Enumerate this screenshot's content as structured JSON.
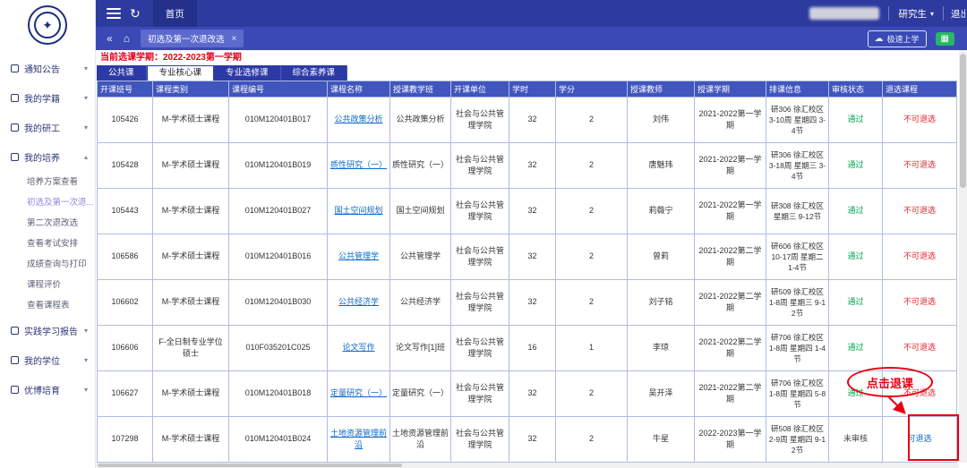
{
  "topbar": {
    "home_tab": "首页",
    "user_role": "研究生",
    "logout_label": "退出"
  },
  "tabbar": {
    "active_tab": "初选及第一次退改选",
    "close_label": "×",
    "speed_button": "极速上学"
  },
  "sidebar": {
    "items": [
      {
        "label": "通知公告"
      },
      {
        "label": "我的学籍"
      },
      {
        "label": "我的研工"
      },
      {
        "label": "我的培养",
        "expanded": true,
        "children": [
          "培养方案查看",
          "初选及第一次退...",
          "第二次退改选",
          "查看考试安排",
          "成绩查询与打印",
          "课程评价",
          "查看课程表"
        ]
      },
      {
        "label": "实践学习报告"
      },
      {
        "label": "我的学位"
      },
      {
        "label": "优博培育"
      }
    ],
    "active_child": "初选及第一次退..."
  },
  "notice": "当前选课学期：2022-2023第一学期",
  "category_tabs": [
    "公共课",
    "专业核心课",
    "专业选修课",
    "综合素养课"
  ],
  "active_category": "专业核心课",
  "table": {
    "columns": [
      "class_no",
      "category",
      "course_no",
      "course_name",
      "teaching_class",
      "unit",
      "hours",
      "credits",
      "teacher",
      "semester",
      "schedule",
      "status",
      "drop"
    ],
    "headers": [
      "开课班号",
      "课程类别",
      "课程编号",
      "课程名称",
      "授课教学班",
      "开课单位",
      "学时",
      "学分",
      "授课教师",
      "授课学期",
      "排课信息",
      "审核状态",
      "退选课程"
    ],
    "rows": [
      {
        "class_no": "105426",
        "category": "M-学术硕士课程",
        "course_no": "010M120401B017",
        "course_name": "公共政策分析",
        "teaching_class": "公共政策分析",
        "unit": "社会与公共管理学院",
        "hours": "32",
        "credits": "2",
        "teacher": "刘伟",
        "semester": "2021-2022第一学期",
        "schedule": "研306 徐汇校区 3-10周 星期四 3-4节",
        "status": "通过",
        "drop": "不可退选"
      },
      {
        "class_no": "105428",
        "category": "M-学术硕士课程",
        "course_no": "010M120401B019",
        "course_name": "质性研究（一）",
        "teaching_class": "质性研究（一）",
        "unit": "社会与公共管理学院",
        "hours": "32",
        "credits": "2",
        "teacher": "唐魅玮",
        "semester": "2021-2022第一学期",
        "schedule": "研306 徐汇校区 3-18周 星期三 3-4节",
        "status": "通过",
        "drop": "不可退选"
      },
      {
        "class_no": "105443",
        "category": "M-学术硕士课程",
        "course_no": "010M120401B027",
        "course_name": "国土空间规划",
        "teaching_class": "国土空间规划",
        "unit": "社会与公共管理学院",
        "hours": "32",
        "credits": "2",
        "teacher": "莉薇宁",
        "semester": "2021-2022第一学期",
        "schedule": "研308 徐汇校区 星期三 9-12节",
        "status": "通过",
        "drop": "不可退选"
      },
      {
        "class_no": "106586",
        "category": "M-学术硕士课程",
        "course_no": "010M120401B016",
        "course_name": "公共管理学",
        "teaching_class": "公共管理学",
        "unit": "社会与公共管理学院",
        "hours": "32",
        "credits": "2",
        "teacher": "曾莉",
        "semester": "2021-2022第二学期",
        "schedule": "研606 徐汇校区 10-17周 星期二 1-4节",
        "status": "通过",
        "drop": "不可退选"
      },
      {
        "class_no": "106602",
        "category": "M-学术硕士课程",
        "course_no": "010M120401B030",
        "course_name": "公共经济学",
        "teaching_class": "公共经济学",
        "unit": "社会与公共管理学院",
        "hours": "32",
        "credits": "2",
        "teacher": "刘子铭",
        "semester": "2021-2022第二学期",
        "schedule": "研509 徐汇校区 1-8周 星期三 9-12节",
        "status": "通过",
        "drop": "不可退选"
      },
      {
        "class_no": "106606",
        "category": "F-全日制专业学位硕士",
        "course_no": "010F035201C025",
        "course_name": "论文写作",
        "teaching_class": "论文写作[1]班",
        "unit": "社会与公共管理学院",
        "hours": "16",
        "credits": "1",
        "teacher": "李琼",
        "semester": "2021-2022第二学期",
        "schedule": "研706 徐汇校区 1-8周 星期四 1-4节",
        "status": "通过",
        "drop": "不可退选"
      },
      {
        "class_no": "106627",
        "category": "M-学术硕士课程",
        "course_no": "010M120401B018",
        "course_name": "定量研究（一）",
        "teaching_class": "定量研究（一）",
        "unit": "社会与公共管理学院",
        "hours": "32",
        "credits": "2",
        "teacher": "吴开泽",
        "semester": "2021-2022第二学期",
        "schedule": "研706 徐汇校区 1-8周 星期四 5-8节",
        "status": "通过",
        "drop": "不可退选"
      },
      {
        "class_no": "107298",
        "category": "M-学术硕士课程",
        "course_no": "010M120401B024",
        "course_name": "土地资源管理前沿",
        "teaching_class": "土地资源管理前沿",
        "unit": "社会与公共管理学院",
        "hours": "32",
        "credits": "2",
        "teacher": "牛星",
        "semester": "2022-2023第一学期",
        "schedule": "研508 徐汇校区 2-9周 星期四 9-12节",
        "status": "未审核",
        "drop": "可退选"
      }
    ]
  },
  "annotation": {
    "label": "点击退课"
  },
  "colors": {
    "topbar": "#2d3a9e",
    "table_header": "#4155be",
    "pass_green": "#00a651",
    "alert_red": "#e60012",
    "link_blue": "#0e68c8"
  }
}
